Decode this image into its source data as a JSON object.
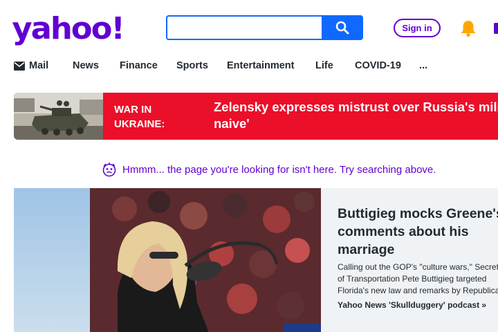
{
  "header": {
    "logo_text": "yahoo!",
    "search": {
      "placeholder": "",
      "value": ""
    },
    "signin_label": "Sign in",
    "brand_color": "#6001d2",
    "search_color": "#0f69ff"
  },
  "nav": {
    "items": [
      {
        "label": "Mail",
        "icon": "mail-icon"
      },
      {
        "label": "News"
      },
      {
        "label": "Finance"
      },
      {
        "label": "Sports"
      },
      {
        "label": "Entertainment"
      },
      {
        "label": "Life"
      },
      {
        "label": "COVID-19"
      },
      {
        "label": "..."
      }
    ]
  },
  "banner": {
    "tag": "WAR IN UKRAINE:",
    "headline_line1": "Zelensky expresses mistrust over Russia's militar",
    "headline_line2": "naive'",
    "color": "#eb0f29"
  },
  "notice": {
    "text": "Hmmm... the page you're looking for isn't here. Try searching above.",
    "icon": "confused-face-icon"
  },
  "feature": {
    "title_lines": [
      "Buttigieg mocks Greene's",
      "comments about his",
      "marriage"
    ],
    "summary_lines": [
      "Calling out the GOP's \"culture wars,\" Secreta",
      "of Transportation Pete Buttigieg targeted",
      "Florida's new law and remarks by Republica"
    ],
    "source": "Yahoo News 'Skullduggery' podcast »"
  }
}
